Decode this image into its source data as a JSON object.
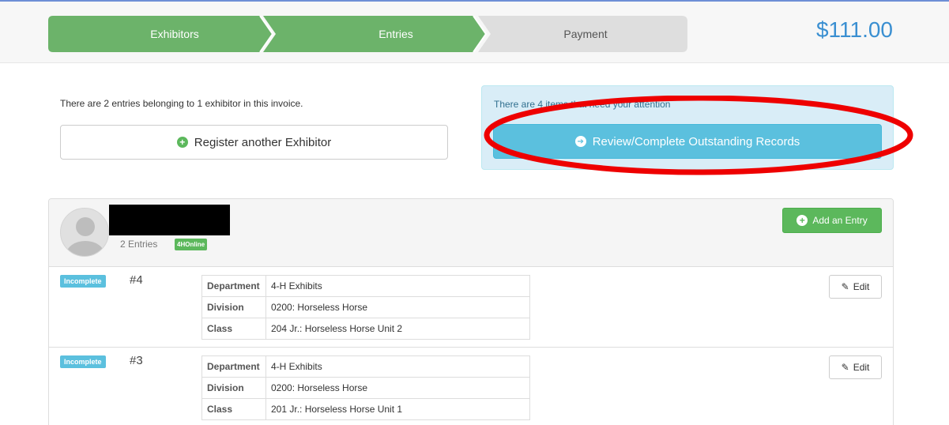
{
  "wizard": {
    "steps": [
      {
        "label": "Exhibitors",
        "state": "complete"
      },
      {
        "label": "Entries",
        "state": "active"
      },
      {
        "label": "Payment",
        "state": "pending"
      }
    ],
    "total": "$111.00"
  },
  "invoice": {
    "message": "There are 2 entries belonging to 1 exhibitor in this invoice.",
    "register_button": "Register another Exhibitor"
  },
  "attention": {
    "message": "There are 4 items that need your attention",
    "review_button": "Review/Complete Outstanding Records"
  },
  "exhibitor": {
    "entries_count": "2 Entries",
    "badge": "4HOnline",
    "add_entry_button": "Add an Entry"
  },
  "entries": [
    {
      "status": "Incomplete",
      "number": "#4",
      "details": [
        {
          "key": "Department",
          "value": "4-H Exhibits"
        },
        {
          "key": "Division",
          "value": "0200: Horseless Horse"
        },
        {
          "key": "Class",
          "value": "204 Jr.: Horseless Horse Unit 2"
        }
      ],
      "edit_label": "Edit"
    },
    {
      "status": "Incomplete",
      "number": "#3",
      "details": [
        {
          "key": "Department",
          "value": "4-H Exhibits"
        },
        {
          "key": "Division",
          "value": "0200: Horseless Horse"
        },
        {
          "key": "Class",
          "value": "201 Jr.: Horseless Horse Unit 1"
        }
      ],
      "edit_label": "Edit"
    }
  ],
  "colors": {
    "step_green": "#6cb36a",
    "step_grey": "#dedede",
    "total_blue": "#3a8fd1",
    "info_bg": "#d9edf7",
    "review_blue": "#5bc0de",
    "annotation_red": "#ee0000"
  }
}
